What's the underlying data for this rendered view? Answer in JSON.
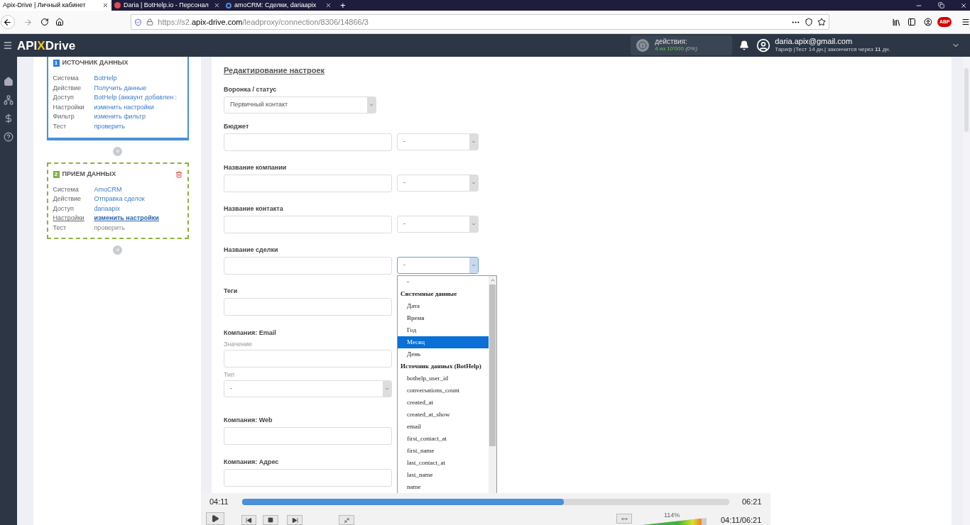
{
  "browser": {
    "tabs": [
      {
        "title": "Apix-Drive | Личный кабинет",
        "selected": true,
        "kind": "plain"
      },
      {
        "title": "Daria | BotHelp.io - Персонал",
        "selected": false,
        "kind": "bothelp"
      },
      {
        "title": "amoCRM: Сделки, dariaapix",
        "selected": false,
        "kind": "amo"
      }
    ],
    "new_tab": "+",
    "url_host": "https://s2.",
    "url_domain": "apix-drive.com",
    "url_path": "/leadproxy/connection/8306/14866/3",
    "extension_badge": "ABP"
  },
  "header": {
    "logo": [
      "API",
      "X",
      "Drive"
    ],
    "actions_label": "действия:",
    "actions_value": "4 из 10'000",
    "actions_percent": "(0%)",
    "email": "daria.apix@gmail.com",
    "plan": "Тариф |Тест 14 дн.| закончится через **11** дн."
  },
  "cards": [
    {
      "number": "1",
      "title": "ИСТОЧНИК ДАННЫХ",
      "kind": "source",
      "deletable": false,
      "rows": [
        {
          "label": "Система",
          "value": "BotHelp",
          "kind": "link"
        },
        {
          "label": "Действие",
          "value": "Получить данные",
          "kind": "link"
        },
        {
          "label": "Доступ",
          "value": "BotHelp (аккаунт добавлен :",
          "kind": "link"
        },
        {
          "label": "Настройки",
          "value": "изменить настройки",
          "kind": "link"
        },
        {
          "label": "Фильтр",
          "value": "изменить фильтр",
          "kind": "link"
        },
        {
          "label": "Тест",
          "value": "проверить",
          "kind": "link"
        }
      ]
    },
    {
      "number": "2",
      "title": "ПРИЕМ ДАННЫХ",
      "kind": "destination",
      "deletable": true,
      "rows": [
        {
          "label": "Система",
          "value": "AmoCRM",
          "kind": "link"
        },
        {
          "label": "Действие",
          "value": "Отправка сделок",
          "kind": "link"
        },
        {
          "label": "Доступ",
          "value": "dariaapix",
          "kind": "link"
        },
        {
          "label": "Настройки",
          "value": "изменить настройки",
          "kind": "current"
        },
        {
          "label": "Тест",
          "value": "проверить",
          "kind": "muted"
        }
      ]
    }
  ],
  "form": {
    "title": "Редактирование настроек",
    "fields": [
      {
        "kind": "select",
        "label": "Воронка / статус",
        "value": "Первичный контакт"
      },
      {
        "kind": "input_select",
        "label": "Бюджет",
        "select_value": "-",
        "open": false
      },
      {
        "kind": "input_select",
        "label": "Название компании",
        "select_value": "-",
        "open": false
      },
      {
        "kind": "input_select",
        "label": "Название контакта",
        "select_value": "-",
        "open": false
      },
      {
        "kind": "input_select",
        "label": "Название сделки",
        "select_value": "-",
        "open": true,
        "options": [
          {
            "text": "-",
            "kind": "option",
            "selected": false
          },
          {
            "text": "Системные данные",
            "kind": "group",
            "selected": false
          },
          {
            "text": "Дата",
            "kind": "option",
            "selected": false
          },
          {
            "text": "Время",
            "kind": "option",
            "selected": false
          },
          {
            "text": "Год",
            "kind": "option",
            "selected": false
          },
          {
            "text": "Месяц",
            "kind": "option",
            "selected": true
          },
          {
            "text": "День",
            "kind": "option",
            "selected": false
          },
          {
            "text": "Источник данных (BotHelp)",
            "kind": "group",
            "selected": false
          },
          {
            "text": "bothelp_user_id",
            "kind": "option",
            "selected": false
          },
          {
            "text": "conversations_count",
            "kind": "option",
            "selected": false
          },
          {
            "text": "created_at",
            "kind": "option",
            "selected": false
          },
          {
            "text": "created_at_show",
            "kind": "option",
            "selected": false
          },
          {
            "text": "email",
            "kind": "option",
            "selected": false
          },
          {
            "text": "first_contact_at",
            "kind": "option",
            "selected": false
          },
          {
            "text": "first_name",
            "kind": "option",
            "selected": false
          },
          {
            "text": "last_contact_at",
            "kind": "option",
            "selected": false
          },
          {
            "text": "last_name",
            "kind": "option",
            "selected": false
          },
          {
            "text": "name",
            "kind": "option",
            "selected": false
          }
        ]
      },
      {
        "kind": "input",
        "label": "Теги"
      },
      {
        "kind": "group",
        "label": "Компания: Email",
        "subfields": [
          {
            "kind": "input",
            "label": "Значение"
          },
          {
            "kind": "select",
            "label": "Тип",
            "value": "-"
          }
        ]
      },
      {
        "kind": "input",
        "label": "Компания: Web"
      },
      {
        "kind": "input",
        "label": "Компания: Адрес"
      }
    ]
  },
  "player": {
    "current": "04:11",
    "duration": "06:21",
    "level": 0.66,
    "volume": {
      "reading": "114%",
      "level": 0.92
    },
    "time_display": "04:11/06:21"
  }
}
